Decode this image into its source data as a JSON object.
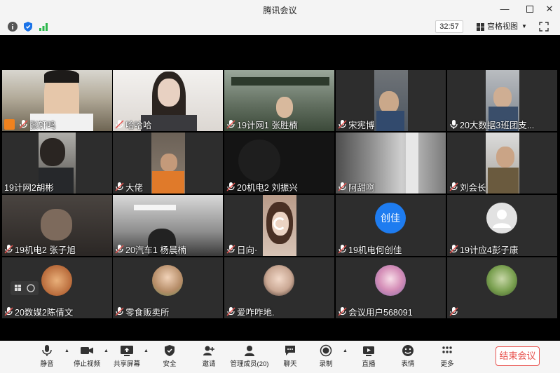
{
  "window": {
    "title": "腾讯会议"
  },
  "info": {
    "timer": "32:57",
    "view_label": "宫格视图"
  },
  "participants": [
    {
      "name": "张轩鸣",
      "role": "host"
    },
    {
      "name": "哈哈哈"
    },
    {
      "name": "19计网1 张胜楠"
    },
    {
      "name": "宋宪博"
    },
    {
      "name": "20大数据3班团支..."
    },
    {
      "name": "19计网2胡彬"
    },
    {
      "name": "大佬"
    },
    {
      "name": "20机电2  刘振兴"
    },
    {
      "name": "阿甜啊"
    },
    {
      "name": "刘会长"
    },
    {
      "name": "19机电2 张子旭"
    },
    {
      "name": "20汽车1 杨晨楠"
    },
    {
      "name": "日向·"
    },
    {
      "name": "19机电何创佳",
      "avatar_text": "创佳",
      "avatar_color": "#1e7cf0"
    },
    {
      "name": "19计应4彭子康"
    },
    {
      "name": "20数媒2陈倩文"
    },
    {
      "name": "零食贩卖所"
    },
    {
      "name": "爱咋咋地."
    },
    {
      "name": "会议用户568091"
    },
    {
      "name": ""
    }
  ],
  "toolbar": {
    "mute": "静音",
    "stop_video": "停止视频",
    "share_screen": "共享屏幕",
    "security": "安全",
    "invite": "邀请",
    "manage_members": "管理成员(20)",
    "chat": "聊天",
    "record": "录制",
    "live": "直播",
    "reactions": "表情",
    "more": "更多",
    "end_meeting": "结束会议"
  },
  "colors": {
    "end_meeting": "#e8534f",
    "host_badge": "#f0821e",
    "avatar_blue": "#1e7cf0"
  }
}
